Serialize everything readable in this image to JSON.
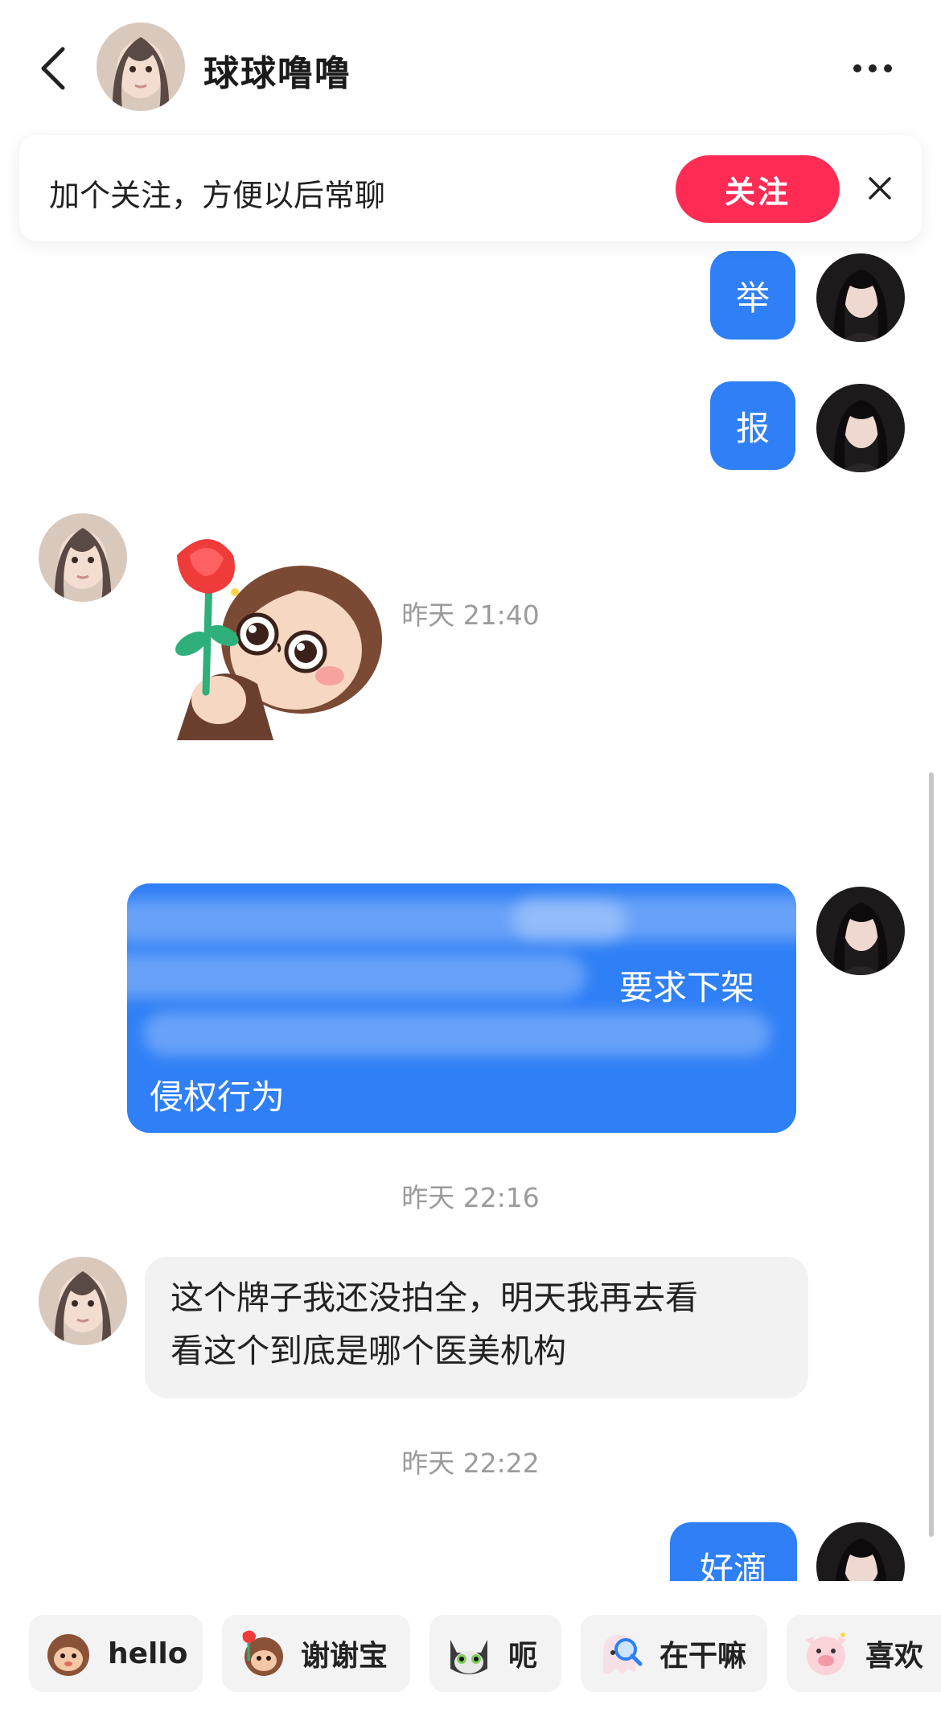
{
  "header": {
    "name": "球球噜噜",
    "back_icon": "chevron-left-icon",
    "more_icon": "more-dots-icon"
  },
  "follow_banner": {
    "text": "加个关注，方便以后常聊",
    "button_label": "关注",
    "close_icon": "close-icon",
    "accent_color": "#fe2c55"
  },
  "messages": {
    "msg1": "举",
    "msg2": "报",
    "sticker": "rose-sticker",
    "time1": "昨天 21:40",
    "long_visible_a": "要求下架",
    "long_visible_b": "侵权行为",
    "time2": "昨天 22:16",
    "reply_line1": "这个牌子我还没拍全，明天我再去看",
    "reply_line2": "看这个到底是哪个医美机构",
    "time3": "昨天 22:22",
    "last": "好滴"
  },
  "colors": {
    "bubble_blue": "#2f7ff6",
    "bubble_grey": "#f2f2f2"
  },
  "quick_replies": [
    {
      "label": "hello",
      "icon": "monkey-icon"
    },
    {
      "label": "谢谢宝",
      "icon": "rose-monkey-icon"
    },
    {
      "label": "呃",
      "icon": "cat-icon"
    },
    {
      "label": "在干嘛",
      "icon": "magnifier-ghost-icon"
    },
    {
      "label": "喜欢",
      "icon": "pig-icon"
    }
  ]
}
